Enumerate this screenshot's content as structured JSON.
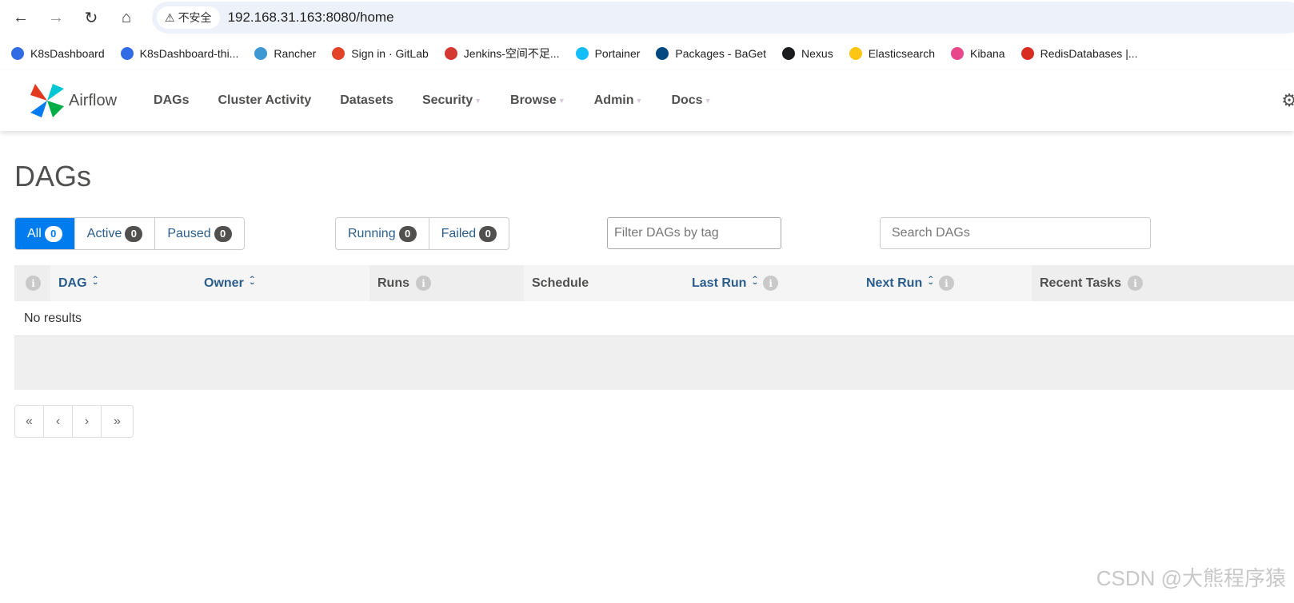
{
  "browser": {
    "security_label": "不安全",
    "url": "192.168.31.163:8080/home",
    "bookmarks": [
      {
        "label": "K8sDashboard",
        "color": "#326ce5"
      },
      {
        "label": "K8sDashboard-thi...",
        "color": "#326ce5"
      },
      {
        "label": "Rancher",
        "color": "#3d98d3"
      },
      {
        "label": "Sign in · GitLab",
        "color": "#e24329"
      },
      {
        "label": "Jenkins-空间不足...",
        "color": "#d33833"
      },
      {
        "label": "Portainer",
        "color": "#13bef9"
      },
      {
        "label": "Packages - BaGet",
        "color": "#004880"
      },
      {
        "label": "Nexus",
        "color": "#1b1c1d"
      },
      {
        "label": "Elasticsearch",
        "color": "#fec514"
      },
      {
        "label": "Kibana",
        "color": "#e8478b"
      },
      {
        "label": "RedisDatabases |...",
        "color": "#d82c20"
      }
    ]
  },
  "nav": {
    "brand": "Airflow",
    "items": [
      {
        "label": "DAGs",
        "dropdown": false
      },
      {
        "label": "Cluster Activity",
        "dropdown": false
      },
      {
        "label": "Datasets",
        "dropdown": false
      },
      {
        "label": "Security",
        "dropdown": true
      },
      {
        "label": "Browse",
        "dropdown": true
      },
      {
        "label": "Admin",
        "dropdown": true
      },
      {
        "label": "Docs",
        "dropdown": true
      }
    ]
  },
  "page": {
    "title": "DAGs",
    "status_filters": [
      {
        "label": "All",
        "count": "0",
        "active": true
      },
      {
        "label": "Active",
        "count": "0"
      },
      {
        "label": "Paused",
        "count": "0"
      }
    ],
    "run_filters": [
      {
        "label": "Running",
        "count": "0"
      },
      {
        "label": "Failed",
        "count": "0"
      }
    ],
    "tag_filter_placeholder": "Filter DAGs by tag",
    "search_placeholder": "Search DAGs",
    "columns": [
      "DAG",
      "Owner",
      "Runs",
      "Schedule",
      "Last Run",
      "Next Run",
      "Recent Tasks"
    ],
    "empty": "No results",
    "pager": [
      "«",
      "‹",
      "›",
      "»"
    ]
  },
  "accent": "#017cee",
  "watermark": "CSDN @大熊程序猿"
}
